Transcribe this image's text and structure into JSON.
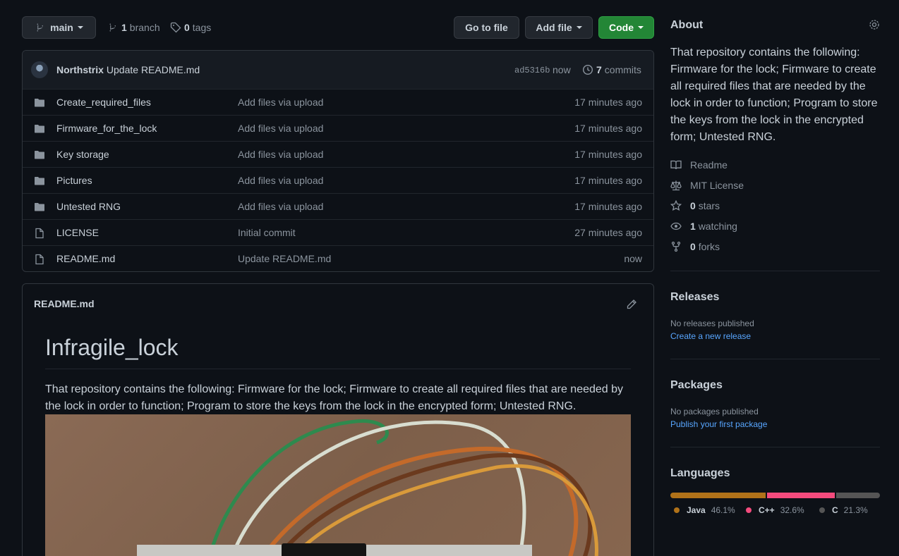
{
  "toolbar": {
    "branch_name": "main",
    "branch_count": "1",
    "branch_label": "branch",
    "tag_count": "0",
    "tag_label": "tags",
    "go_to_file": "Go to file",
    "add_file": "Add file",
    "code": "Code"
  },
  "commit": {
    "author": "Northstrix",
    "message": "Update README.md",
    "hash": "ad5316b",
    "time": "now",
    "count": "7",
    "count_label": "commits"
  },
  "files": [
    {
      "name": "Create_required_files",
      "message": "Add files via upload",
      "age": "17 minutes ago",
      "type": "folder"
    },
    {
      "name": "Firmware_for_the_lock",
      "message": "Add files via upload",
      "age": "17 minutes ago",
      "type": "folder"
    },
    {
      "name": "Key storage",
      "message": "Add files via upload",
      "age": "17 minutes ago",
      "type": "folder"
    },
    {
      "name": "Pictures",
      "message": "Add files via upload",
      "age": "17 minutes ago",
      "type": "folder"
    },
    {
      "name": "Untested RNG",
      "message": "Add files via upload",
      "age": "17 minutes ago",
      "type": "folder"
    },
    {
      "name": "LICENSE",
      "message": "Initial commit",
      "age": "27 minutes ago",
      "type": "file"
    },
    {
      "name": "README.md",
      "message": "Update README.md",
      "age": "now",
      "type": "file"
    }
  ],
  "readme": {
    "filename": "README.md",
    "title": "Infragile_lock",
    "body": "That repository contains the following: Firmware for the lock; Firmware to create all required files that are needed by the lock in order to function; Program to store the keys from the lock in the encrypted form; Untested RNG."
  },
  "about": {
    "heading": "About",
    "description": "That repository contains the following: Firmware for the lock; Firmware to create all required files that are needed by the lock in order to function; Program to store the keys from the lock in the encrypted form; Untested RNG.",
    "readme": "Readme",
    "license": "MIT License",
    "stars_count": "0",
    "stars_label": "stars",
    "watching_count": "1",
    "watching_label": "watching",
    "forks_count": "0",
    "forks_label": "forks"
  },
  "releases": {
    "heading": "Releases",
    "none": "No releases published",
    "link": "Create a new release"
  },
  "packages": {
    "heading": "Packages",
    "none": "No packages published",
    "link": "Publish your first package"
  },
  "languages": {
    "heading": "Languages",
    "items": [
      {
        "name": "Java",
        "percent": "46.1%",
        "value": 46.1,
        "color": "#b07219"
      },
      {
        "name": "C++",
        "percent": "32.6%",
        "value": 32.6,
        "color": "#f34b7d"
      },
      {
        "name": "C",
        "percent": "21.3%",
        "value": 21.3,
        "color": "#555555"
      }
    ]
  },
  "colors": {
    "background": "#0d1117",
    "accent_green": "#238636",
    "link": "#58a6ff"
  }
}
